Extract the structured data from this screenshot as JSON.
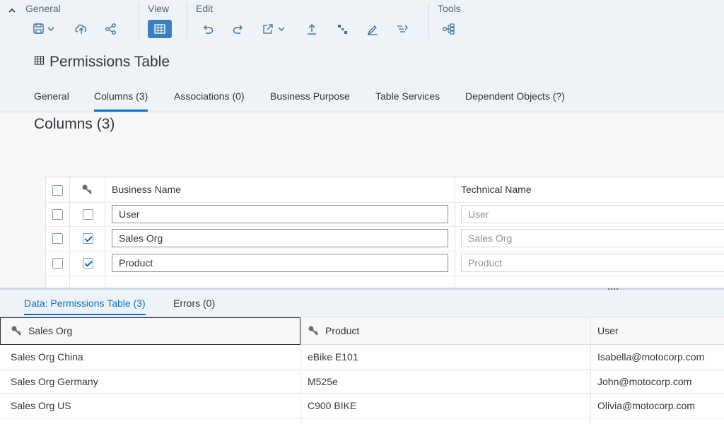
{
  "toolbar": {
    "groups": [
      {
        "title": "General"
      },
      {
        "title": "View"
      },
      {
        "title": "Edit"
      },
      {
        "title": "Tools"
      }
    ],
    "icons": {
      "collapse": "chevron-up-icon",
      "save": "save-icon",
      "deploy": "cloud-upload-icon",
      "share": "share-icon",
      "table_view": "table-view-icon",
      "undo": "undo-icon",
      "redo": "redo-icon",
      "export": "export-icon",
      "upload": "upload-icon",
      "hierarchy": "hierarchy-icon",
      "edit": "pencil-icon",
      "sort": "sort-icon",
      "impact": "impact-lineage-icon"
    }
  },
  "header": {
    "title": "Permissions Table",
    "tabs": [
      {
        "label": "General"
      },
      {
        "label": "Columns (3)"
      },
      {
        "label": "Associations (0)"
      },
      {
        "label": "Business Purpose"
      },
      {
        "label": "Table Services"
      },
      {
        "label": "Dependent Objects (?)"
      }
    ],
    "active_tab": "Columns (3)"
  },
  "columns_section": {
    "title": "Columns (3)",
    "headers": {
      "business_name": "Business Name",
      "technical_name": "Technical Name"
    },
    "rows": [
      {
        "selected": false,
        "key": false,
        "business_name": "User",
        "technical_name": "User"
      },
      {
        "selected": false,
        "key": true,
        "business_name": "Sales Org",
        "technical_name": "Sales Org"
      },
      {
        "selected": false,
        "key": true,
        "business_name": "Product",
        "technical_name": "Product"
      }
    ]
  },
  "bottom_panel": {
    "tabs": [
      {
        "label": "Data: Permissions Table (3)"
      },
      {
        "label": "Errors (0)"
      }
    ],
    "headers": [
      "Sales Org",
      "Product",
      "User"
    ],
    "rows": [
      [
        "Sales Org China",
        "eBike E101",
        "Isabella@motocorp.com"
      ],
      [
        "Sales Org Germany",
        "M525e",
        "John@motocorp.com"
      ],
      [
        "Sales Org US",
        "C900 BIKE",
        "Olivia@motocorp.com"
      ]
    ]
  },
  "colors": {
    "accent": "#0a6ed1",
    "toolbar_bg": "#eef3f8"
  }
}
